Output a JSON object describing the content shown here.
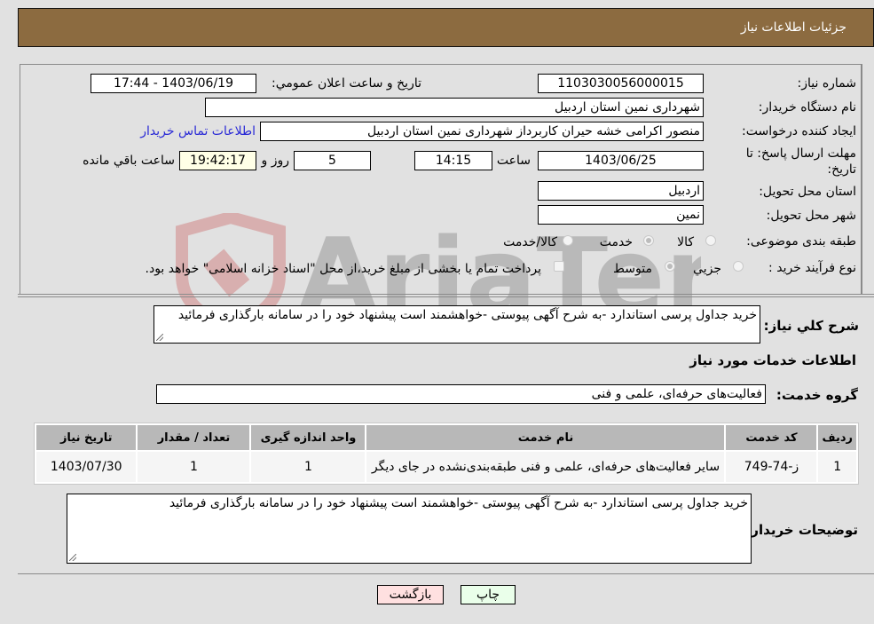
{
  "header": {
    "title": "جزئیات اطلاعات نیاز"
  },
  "form": {
    "need_number": {
      "label": "شماره نیاز:",
      "value": "1103030056000015"
    },
    "announce_datetime": {
      "label": "تاریخ و ساعت اعلان عمومي:",
      "value": "1403/06/19 - 17:44"
    },
    "buyer_org": {
      "label": "نام دستگاه خریدار:",
      "value": "شهرداری نمین استان اردبیل"
    },
    "requester": {
      "label": "ایجاد کننده درخواست:",
      "value": "منصور اکرامی خشه حیران کاربرداز شهرداری نمین استان اردبیل"
    },
    "buyer_contact_link": "اطلاعات تماس خریدار",
    "deadline": {
      "label_line1": "مهلت ارسال پاسخ: تا",
      "label_line2": "تاریخ:",
      "date": "1403/06/25",
      "time_label": "ساعت",
      "time": "14:15",
      "days": "5",
      "days_label": "روز و",
      "remaining": "19:42:17",
      "remaining_label": "ساعت باقي مانده"
    },
    "delivery_province": {
      "label": "استان محل تحویل:",
      "value": "اردبیل"
    },
    "delivery_city": {
      "label": "شهر محل تحویل:",
      "value": "نمین"
    },
    "category": {
      "label": "طبقه بندی موضوعی:",
      "options": [
        "کالا",
        "خدمت",
        "کالا/خدمت"
      ],
      "selected": "خدمت"
    },
    "purchase_type": {
      "label": "نوع فرآیند خرید :",
      "options": [
        "جزيي",
        "متوسط"
      ],
      "selected": "متوسط",
      "treasury_note": "پرداخت تمام یا بخشی از مبلغ خرید،از محل \"اسناد خزانه اسلامی\" خواهد بود."
    }
  },
  "description": {
    "label": "شرح كلي نیاز:",
    "value": "خرید جداول پرسی استاندارد -به شرح آگهی پیوستی -خواهشمند است پیشنهاد خود را در سامانه بارگذاری فرمائید"
  },
  "services": {
    "section_title": "اطلاعات خدمات مورد نیاز",
    "group_label": "گروه خدمت:",
    "group_value": "فعالیت‌های حرفه‌ای، علمی و فنی",
    "table": {
      "headers": [
        "ردیف",
        "کد خدمت",
        "نام خدمت",
        "واحد اندازه گیری",
        "تعداد / مقدار",
        "تاریخ نیاز"
      ],
      "rows": [
        [
          "1",
          "ز-74-749",
          "سایر فعالیت‌های حرفه‌ای، علمی و فنی طبقه‌بندی‌نشده در جای دیگر",
          "1",
          "1",
          "1403/07/30"
        ]
      ]
    }
  },
  "buyer_notes": {
    "label": "توضیحات خریدار:",
    "value": "خرید جداول پرسی استاندارد -به شرح آگهی پیوستی -خواهشمند است پیشنهاد خود را در سامانه بارگذاری فرمائید"
  },
  "buttons": {
    "print": "چاپ",
    "back": "بازگشت"
  },
  "watermark": {
    "text": "AriaTender.neT"
  },
  "colors": {
    "header_bg": "#8c6b40",
    "print_bg": "#eaffea",
    "back_bg": "#ffe0e0",
    "link": "#2929d6"
  }
}
